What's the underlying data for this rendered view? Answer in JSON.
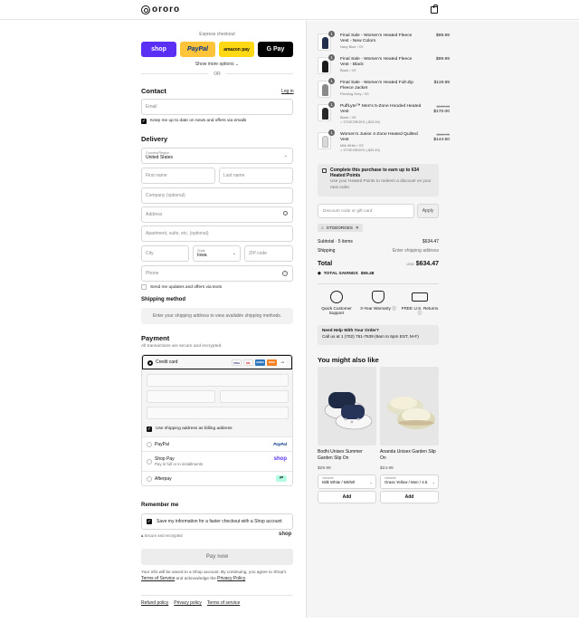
{
  "header": {
    "brand": "ororo"
  },
  "express": {
    "title": "Express checkout",
    "shop": "shop",
    "paypal": "PayPal",
    "amazon": "amazon pay",
    "gpay": "G Pay",
    "show_more": "Show more options ⌄",
    "or": "OR"
  },
  "contact": {
    "title": "Contact",
    "login": "Log in",
    "email_placeholder": "Email",
    "newsletter": "Keep me up to date on news and offers via emails"
  },
  "delivery": {
    "title": "Delivery",
    "country_label": "Country/Region",
    "country_value": "United States",
    "first_name": "First name",
    "last_name": "Last name",
    "company": "Company (optional)",
    "address": "Address",
    "apartment": "Apartment, suite, etc. (optional)",
    "city": "City",
    "state_label": "State",
    "state_value": "Iowa",
    "zip": "ZIP code",
    "phone": "Phone",
    "sms": "Send me updates and offers via texts"
  },
  "shipping": {
    "title": "Shipping method",
    "info": "Enter your shipping address to view available shipping methods."
  },
  "payment": {
    "title": "Payment",
    "subtitle": "All transactions are secure and encrypted.",
    "credit_card": "Credit card",
    "billing_same": "Use shipping address as billing address",
    "paypal": "PayPal",
    "paypal_logo": "PayPal",
    "shop_pay": "Shop Pay",
    "shop_pay_sub": "Pay in full or in installments",
    "shop_logo": "shop",
    "afterpay": "Afterpay",
    "card_brands": [
      "VISA",
      "MC",
      "AMEX",
      "DISC",
      "+4"
    ]
  },
  "remember": {
    "title": "Remember me",
    "save_info": "Save my information for a faster checkout with a Shop account",
    "secure": "Secure and encrypted",
    "shop": "shop"
  },
  "pay_now": "Pay now",
  "footer": {
    "note_1": "Your info will be saved to a Shop account. By continuing, you agree to Shop's",
    "tos": "Terms of Service",
    "note_2": " and acknowledge the ",
    "privacy": "Privacy Policy",
    "links": [
      "Refund policy",
      "Privacy policy",
      "Terms of service"
    ]
  },
  "cart": {
    "items": [
      {
        "qty": "1",
        "name": "Final Sale - Women's Heated Fleece Vest - New Colors",
        "variant": "Navy Blue / XS",
        "price": "$99.99",
        "color": "#23304d"
      },
      {
        "qty": "1",
        "name": "Final Sale - Women's Heated Fleece Vest - Black",
        "variant": "Black / XS",
        "price": "$99.99",
        "color": "#1b1b1b"
      },
      {
        "qty": "1",
        "name": "Final Sale - Women's Heated Full-Zip Fleece Jacket",
        "variant": "Flecking Grey / XS",
        "price": "$119.99",
        "color": "#8a8a8a"
      },
      {
        "qty": "1",
        "name": "PuffLyte™ Men's 5-Zone Hooded Heated Vest",
        "variant": "Black / XS",
        "discount": "STGEORGES (-$29.99)",
        "old_price": "$199.99",
        "price": "$170.00",
        "color": "#2a2a2a"
      },
      {
        "qty": "1",
        "name": "Women's Junior 4-Zone Heated Quilted Vest",
        "variant": "Milk White / XS",
        "discount": "STGEORGES (-$25.49)",
        "old_price": "$169.99",
        "price": "$144.50",
        "color": "#d9d9d9"
      }
    ],
    "points_title": "Complete this purchase to earn up to 634 Heated Points",
    "points_sub": "Use your Heated Points to redeem a discount on your next order.",
    "discount_placeholder": "Discount code or gift card",
    "apply": "Apply",
    "applied_code": "STGEORGES",
    "subtotal_label": "Subtotal · 5 items",
    "subtotal_value": "$634.47",
    "shipping_label": "Shipping",
    "shipping_value": "Enter shipping address",
    "total_label": "Total",
    "currency": "USD",
    "total_value": "$634.47",
    "savings_label": "TOTAL SAVINGS",
    "savings_value": "$55.48"
  },
  "features": [
    {
      "label": "Quick Customer Support",
      "icon": "headset-icon"
    },
    {
      "label": "3-Year Warranty ⓘ",
      "icon": "shield-icon"
    },
    {
      "label": "FREE U.S. Returns ⓘ",
      "icon": "truck-icon"
    }
  ],
  "help": {
    "title": "Need Help With Your Order?",
    "text": "Call us at 1 (702) 751-7639 (9am to 6pm EST, M-F)"
  },
  "recommend": {
    "title": "You might also like",
    "products": [
      {
        "name": "Bodhi Unisex Summer Garden Slip On",
        "price": "$29.99",
        "variant_label": "Variants",
        "variant_value": "Milk White / Mk/Wl",
        "add": "Add"
      },
      {
        "name": "Ananda Unisex Garden Slip On",
        "price": "$24.99",
        "variant_label": "Variants",
        "variant_value": "Grass Yellow / Men / 4.5",
        "add": "Add"
      }
    ]
  },
  "colors": {
    "shop": "#5a31f4",
    "paypal": "#ffc439",
    "amazon": "#ffd814",
    "panel": "#f5f5f5"
  }
}
